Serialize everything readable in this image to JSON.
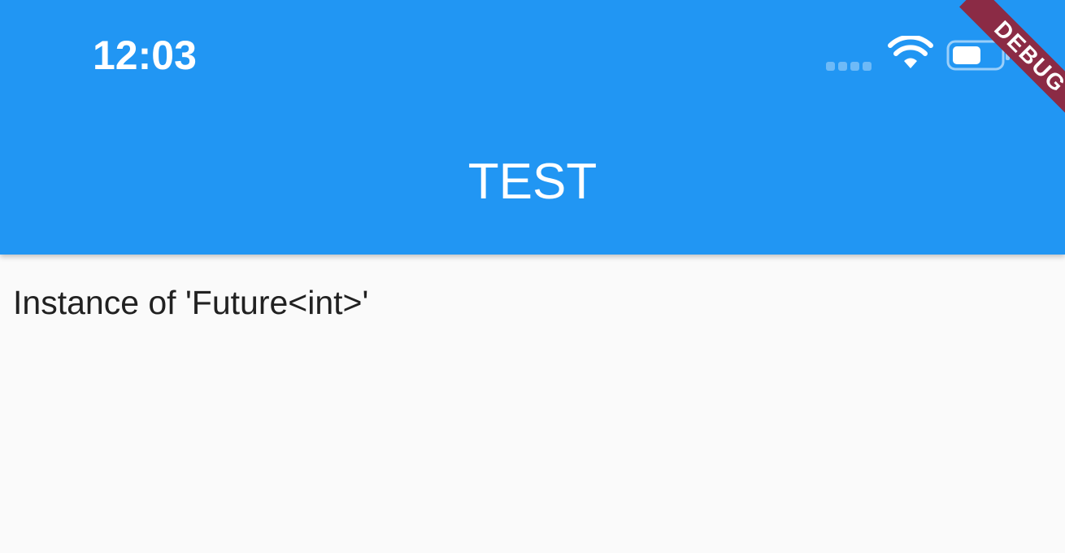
{
  "status_bar": {
    "time": "12:03",
    "wifi_icon": "wifi-icon",
    "battery_icon": "battery-icon",
    "signal_icon": "signal-dots-icon"
  },
  "app_bar": {
    "title": "TEST",
    "background": "#2196f3"
  },
  "body": {
    "text": "Instance of 'Future<int>'"
  },
  "debug_banner": {
    "label": "DEBUG",
    "color": "#8b2b45"
  }
}
